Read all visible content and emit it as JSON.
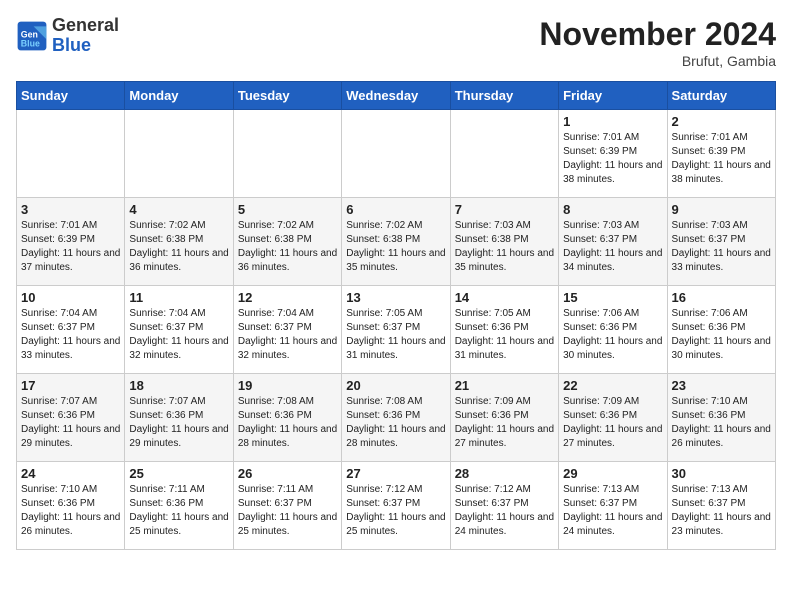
{
  "header": {
    "logo": {
      "general": "General",
      "blue": "Blue"
    },
    "title": "November 2024",
    "location": "Brufut, Gambia"
  },
  "weekdays": [
    "Sunday",
    "Monday",
    "Tuesday",
    "Wednesday",
    "Thursday",
    "Friday",
    "Saturday"
  ],
  "weeks": [
    [
      {
        "day": "",
        "text": ""
      },
      {
        "day": "",
        "text": ""
      },
      {
        "day": "",
        "text": ""
      },
      {
        "day": "",
        "text": ""
      },
      {
        "day": "",
        "text": ""
      },
      {
        "day": "1",
        "text": "Sunrise: 7:01 AM\nSunset: 6:39 PM\nDaylight: 11 hours and 38 minutes."
      },
      {
        "day": "2",
        "text": "Sunrise: 7:01 AM\nSunset: 6:39 PM\nDaylight: 11 hours and 38 minutes."
      }
    ],
    [
      {
        "day": "3",
        "text": "Sunrise: 7:01 AM\nSunset: 6:39 PM\nDaylight: 11 hours and 37 minutes."
      },
      {
        "day": "4",
        "text": "Sunrise: 7:02 AM\nSunset: 6:38 PM\nDaylight: 11 hours and 36 minutes."
      },
      {
        "day": "5",
        "text": "Sunrise: 7:02 AM\nSunset: 6:38 PM\nDaylight: 11 hours and 36 minutes."
      },
      {
        "day": "6",
        "text": "Sunrise: 7:02 AM\nSunset: 6:38 PM\nDaylight: 11 hours and 35 minutes."
      },
      {
        "day": "7",
        "text": "Sunrise: 7:03 AM\nSunset: 6:38 PM\nDaylight: 11 hours and 35 minutes."
      },
      {
        "day": "8",
        "text": "Sunrise: 7:03 AM\nSunset: 6:37 PM\nDaylight: 11 hours and 34 minutes."
      },
      {
        "day": "9",
        "text": "Sunrise: 7:03 AM\nSunset: 6:37 PM\nDaylight: 11 hours and 33 minutes."
      }
    ],
    [
      {
        "day": "10",
        "text": "Sunrise: 7:04 AM\nSunset: 6:37 PM\nDaylight: 11 hours and 33 minutes."
      },
      {
        "day": "11",
        "text": "Sunrise: 7:04 AM\nSunset: 6:37 PM\nDaylight: 11 hours and 32 minutes."
      },
      {
        "day": "12",
        "text": "Sunrise: 7:04 AM\nSunset: 6:37 PM\nDaylight: 11 hours and 32 minutes."
      },
      {
        "day": "13",
        "text": "Sunrise: 7:05 AM\nSunset: 6:37 PM\nDaylight: 11 hours and 31 minutes."
      },
      {
        "day": "14",
        "text": "Sunrise: 7:05 AM\nSunset: 6:36 PM\nDaylight: 11 hours and 31 minutes."
      },
      {
        "day": "15",
        "text": "Sunrise: 7:06 AM\nSunset: 6:36 PM\nDaylight: 11 hours and 30 minutes."
      },
      {
        "day": "16",
        "text": "Sunrise: 7:06 AM\nSunset: 6:36 PM\nDaylight: 11 hours and 30 minutes."
      }
    ],
    [
      {
        "day": "17",
        "text": "Sunrise: 7:07 AM\nSunset: 6:36 PM\nDaylight: 11 hours and 29 minutes."
      },
      {
        "day": "18",
        "text": "Sunrise: 7:07 AM\nSunset: 6:36 PM\nDaylight: 11 hours and 29 minutes."
      },
      {
        "day": "19",
        "text": "Sunrise: 7:08 AM\nSunset: 6:36 PM\nDaylight: 11 hours and 28 minutes."
      },
      {
        "day": "20",
        "text": "Sunrise: 7:08 AM\nSunset: 6:36 PM\nDaylight: 11 hours and 28 minutes."
      },
      {
        "day": "21",
        "text": "Sunrise: 7:09 AM\nSunset: 6:36 PM\nDaylight: 11 hours and 27 minutes."
      },
      {
        "day": "22",
        "text": "Sunrise: 7:09 AM\nSunset: 6:36 PM\nDaylight: 11 hours and 27 minutes."
      },
      {
        "day": "23",
        "text": "Sunrise: 7:10 AM\nSunset: 6:36 PM\nDaylight: 11 hours and 26 minutes."
      }
    ],
    [
      {
        "day": "24",
        "text": "Sunrise: 7:10 AM\nSunset: 6:36 PM\nDaylight: 11 hours and 26 minutes."
      },
      {
        "day": "25",
        "text": "Sunrise: 7:11 AM\nSunset: 6:36 PM\nDaylight: 11 hours and 25 minutes."
      },
      {
        "day": "26",
        "text": "Sunrise: 7:11 AM\nSunset: 6:37 PM\nDaylight: 11 hours and 25 minutes."
      },
      {
        "day": "27",
        "text": "Sunrise: 7:12 AM\nSunset: 6:37 PM\nDaylight: 11 hours and 25 minutes."
      },
      {
        "day": "28",
        "text": "Sunrise: 7:12 AM\nSunset: 6:37 PM\nDaylight: 11 hours and 24 minutes."
      },
      {
        "day": "29",
        "text": "Sunrise: 7:13 AM\nSunset: 6:37 PM\nDaylight: 11 hours and 24 minutes."
      },
      {
        "day": "30",
        "text": "Sunrise: 7:13 AM\nSunset: 6:37 PM\nDaylight: 11 hours and 23 minutes."
      }
    ]
  ]
}
